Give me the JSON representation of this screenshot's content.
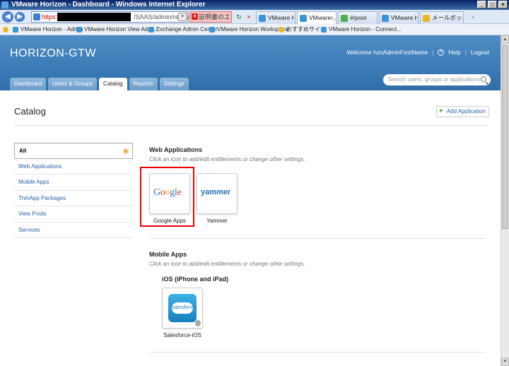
{
  "browser": {
    "title": "VMware Horizon - Dashboard - Windows Internet Explorer",
    "url_scheme": "https://",
    "url_path": "/SAAS/admin/resources",
    "cert_error": "証明書のエラー",
    "tabs": [
      {
        "label": "VMware Ho..."
      },
      {
        "label": "VMware ..."
      },
      {
        "label": "#/pool"
      },
      {
        "label": "VMware Ho..."
      },
      {
        "label": "メールボック..."
      }
    ],
    "favorites": [
      {
        "label": "VMware Horizon - Admin"
      },
      {
        "label": "VMware Horizon View Adm..."
      },
      {
        "label": "Exchange Admin Center"
      },
      {
        "label": "VMware Horizon Workspace"
      },
      {
        "label": "おすすめサイト"
      },
      {
        "label": "VMware Horizon - Connect..."
      }
    ]
  },
  "header": {
    "brand": "HORIZON-GTW",
    "welcome": "Welcome hznAdminFirstName",
    "help": "Help",
    "logout": "Logout",
    "search_placeholder": "Search users, groups or applications",
    "tabs": [
      {
        "label": "Dashboard"
      },
      {
        "label": "Users & Groups"
      },
      {
        "label": "Catalog"
      },
      {
        "label": "Reports"
      },
      {
        "label": "Settings"
      }
    ]
  },
  "page": {
    "title": "Catalog",
    "add_app": "Add Application"
  },
  "sidebar": {
    "items": [
      {
        "label": "All"
      },
      {
        "label": "Web Applications"
      },
      {
        "label": "Mobile Apps"
      },
      {
        "label": "ThinApp Packages"
      },
      {
        "label": "View Pools"
      },
      {
        "label": "Services"
      }
    ]
  },
  "web_apps": {
    "title": "Web Applications",
    "subtitle": "Click an icon to add/edit entitlements or change other settings.",
    "apps": [
      {
        "label": "Google Apps",
        "logo": "Google"
      },
      {
        "label": "Yammer",
        "logo": "yammer"
      }
    ]
  },
  "mobile_apps": {
    "title": "Mobile Apps",
    "subtitle": "Click an icon to add/edit entitlements or change other settings.",
    "platform": "iOS (iPhone and iPad)",
    "apps": [
      {
        "label": "Salesforce-iOS",
        "logo": "salesforce"
      }
    ]
  },
  "colors": {
    "header_blue": "#3a7bb8",
    "link_blue": "#2a62a8",
    "highlight_red": "#e00000"
  }
}
